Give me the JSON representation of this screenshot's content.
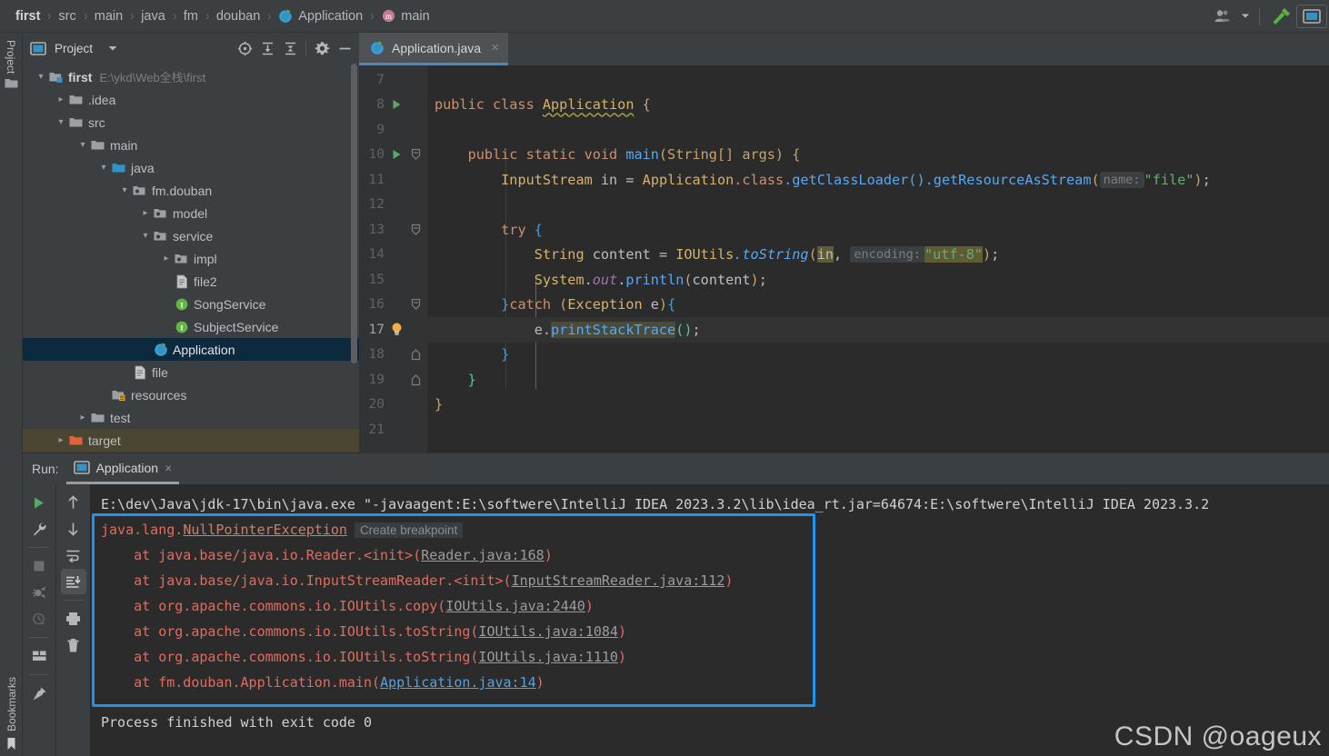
{
  "breadcrumb": {
    "items": [
      {
        "label": "first",
        "icon": null
      },
      {
        "label": "src",
        "icon": null
      },
      {
        "label": "main",
        "icon": null
      },
      {
        "label": "java",
        "icon": null
      },
      {
        "label": "fm",
        "icon": null
      },
      {
        "label": "douban",
        "icon": null
      },
      {
        "label": "Application",
        "icon": "java-class-run-icon"
      },
      {
        "label": "main",
        "icon": "method-icon"
      }
    ],
    "separator": "›"
  },
  "topbar_right": {
    "account_icon": "user-account-icon",
    "account_chevron": "chevron-down-icon",
    "build_icon": "hammer-icon",
    "layout_icon": "window-layout-icon"
  },
  "left_strip": {
    "project_label": "Project",
    "project_icon": "folder-icon",
    "bookmarks_label": "Bookmarks",
    "bookmarks_icon": "bookmark-icon"
  },
  "project_panel": {
    "title": "Project",
    "title_icon": "project-window-icon",
    "title_chevron": "chevron-down-icon",
    "toolbar": [
      {
        "name": "select-opened-file-icon",
        "label": "Select Opened File"
      },
      {
        "name": "expand-all-icon",
        "label": "Expand All"
      },
      {
        "name": "collapse-all-icon",
        "label": "Collapse All"
      },
      {
        "name": "settings-gear-icon",
        "label": "Settings"
      },
      {
        "name": "hide-icon",
        "label": "Hide"
      }
    ],
    "tree": [
      {
        "label": "first",
        "path": "E:\\ykd\\Web全栈\\first",
        "indent": 0,
        "arrow": "down",
        "icon": "module-icon",
        "bold": true,
        "state": "normal"
      },
      {
        "label": ".idea",
        "path": "",
        "indent": 1,
        "arrow": "right",
        "icon": "folder-icon",
        "bold": false,
        "state": "normal"
      },
      {
        "label": "src",
        "path": "",
        "indent": 1,
        "arrow": "down",
        "icon": "folder-icon",
        "bold": false,
        "state": "normal"
      },
      {
        "label": "main",
        "path": "",
        "indent": 2,
        "arrow": "down",
        "icon": "folder-icon",
        "bold": false,
        "state": "normal"
      },
      {
        "label": "java",
        "path": "",
        "indent": 3,
        "arrow": "down",
        "icon": "source-folder-icon",
        "bold": false,
        "state": "normal"
      },
      {
        "label": "fm.douban",
        "path": "",
        "indent": 4,
        "arrow": "down",
        "icon": "package-icon",
        "bold": false,
        "state": "normal"
      },
      {
        "label": "model",
        "path": "",
        "indent": 5,
        "arrow": "right",
        "icon": "package-icon",
        "bold": false,
        "state": "normal"
      },
      {
        "label": "service",
        "path": "",
        "indent": 5,
        "arrow": "down",
        "icon": "package-icon",
        "bold": false,
        "state": "normal"
      },
      {
        "label": "impl",
        "path": "",
        "indent": 6,
        "arrow": "right",
        "icon": "package-icon",
        "bold": false,
        "state": "normal"
      },
      {
        "label": "file2",
        "path": "",
        "indent": 6,
        "arrow": "none",
        "icon": "file-text-icon",
        "bold": false,
        "state": "normal"
      },
      {
        "label": "SongService",
        "path": "",
        "indent": 6,
        "arrow": "none",
        "icon": "interface-icon",
        "bold": false,
        "state": "normal"
      },
      {
        "label": "SubjectService",
        "path": "",
        "indent": 6,
        "arrow": "none",
        "icon": "interface-icon",
        "bold": false,
        "state": "normal"
      },
      {
        "label": "Application",
        "path": "",
        "indent": 5,
        "arrow": "none",
        "icon": "java-class-run-icon",
        "bold": false,
        "state": "selected"
      },
      {
        "label": "file",
        "path": "",
        "indent": 4,
        "arrow": "none",
        "icon": "file-text-icon",
        "bold": false,
        "state": "normal"
      },
      {
        "label": "resources",
        "path": "",
        "indent": 3,
        "arrow": "none",
        "icon": "resources-folder-icon",
        "bold": false,
        "state": "normal"
      },
      {
        "label": "test",
        "path": "",
        "indent": 2,
        "arrow": "right",
        "icon": "folder-icon",
        "bold": false,
        "state": "normal"
      },
      {
        "label": "target",
        "path": "",
        "indent": 1,
        "arrow": "right",
        "icon": "excluded-folder-icon",
        "bold": false,
        "state": "highlight"
      }
    ]
  },
  "editor": {
    "tab": {
      "label": "Application.java",
      "icon": "java-class-run-icon",
      "close": "×"
    },
    "lines": [
      {
        "num": "7",
        "marker": "",
        "fold": "",
        "current": false
      },
      {
        "num": "8",
        "marker": "run-gutter-icon",
        "fold": "",
        "current": false
      },
      {
        "num": "9",
        "marker": "",
        "fold": "",
        "current": false
      },
      {
        "num": "10",
        "marker": "run-gutter-icon",
        "fold": "fold-start",
        "current": false
      },
      {
        "num": "11",
        "marker": "",
        "fold": "",
        "current": false
      },
      {
        "num": "12",
        "marker": "",
        "fold": "",
        "current": false
      },
      {
        "num": "13",
        "marker": "",
        "fold": "fold-start",
        "current": false
      },
      {
        "num": "14",
        "marker": "",
        "fold": "",
        "current": false
      },
      {
        "num": "15",
        "marker": "",
        "fold": "",
        "current": false
      },
      {
        "num": "16",
        "marker": "",
        "fold": "fold-start",
        "current": false
      },
      {
        "num": "17",
        "marker": "lightbulb-icon",
        "fold": "",
        "current": true
      },
      {
        "num": "18",
        "marker": "",
        "fold": "fold-end",
        "current": false
      },
      {
        "num": "19",
        "marker": "",
        "fold": "fold-end",
        "current": false
      },
      {
        "num": "20",
        "marker": "",
        "fold": "",
        "current": false
      },
      {
        "num": "21",
        "marker": "",
        "fold": "",
        "current": false
      }
    ],
    "code": {
      "l7": "",
      "l8_kw": "public class",
      "l8_cls": "Application",
      "l8_brace": "{",
      "l9": "",
      "l10_kw": "public static void",
      "l10_meth": "main",
      "l10_args": "(String[] args) {",
      "l11_type": "InputStream",
      "l11_var": "in",
      "l11_eq": "=",
      "l11_cls": "Application",
      "l11_class_kw": ".class",
      "l11_m1": ".getClassLoader()",
      "l11_m2": ".getResourceAsStream",
      "l11_hint": "name:",
      "l11_str": "\"file\"",
      "l12": "",
      "l13_kw": "try",
      "l13_brace": "{",
      "l14_type": "String",
      "l14_var": "content",
      "l14_eq": "=",
      "l14_cls": "IOUtils",
      "l14_meth": ".toString",
      "l14_arg": "in",
      "l14_hint": "encoding:",
      "l14_str": "\"utf-8\"",
      "l15_cls": "System",
      "l15_fld": "out",
      "l15_meth": "println",
      "l15_arg": "content",
      "l16_catch": "}catch (Exception e){",
      "l17_var": "e.",
      "l17_meth": "printStackTrace",
      "l17_tail": "();",
      "l18": "}",
      "l19": "}",
      "l20": "}",
      "l21": ""
    }
  },
  "run_panel": {
    "label": "Run:",
    "tab": {
      "label": "Application",
      "icon": "run-config-icon",
      "close": "×"
    },
    "toolbar_left": [
      {
        "name": "rerun-play-icon",
        "active": false
      },
      {
        "name": "wrench-settings-icon",
        "active": false
      },
      {
        "name": "stop-square-icon",
        "active": false
      },
      {
        "name": "restart-debug-icon",
        "active": false
      },
      {
        "name": "history-clock-icon",
        "active": false
      },
      {
        "name": "layout-grid-icon",
        "active": false
      },
      {
        "name": "pin-icon",
        "active": false
      }
    ],
    "toolbar_right": [
      {
        "name": "up-arrow-icon",
        "active": false
      },
      {
        "name": "down-arrow-icon",
        "active": false
      },
      {
        "name": "soft-wrap-icon",
        "active": false
      },
      {
        "name": "scroll-to-end-icon",
        "active": true
      },
      {
        "name": "print-icon",
        "active": false
      },
      {
        "name": "trash-delete-icon",
        "active": false
      }
    ],
    "console": {
      "command_line": "E:\\dev\\Java\\jdk-17\\bin\\java.exe \"-javaagent:E:\\softwere\\IntelliJ IDEA 2023.3.2\\lib\\idea_rt.jar=64674:E:\\softwere\\IntelliJ IDEA 2023.3.2",
      "exception_prefix": "java.lang.",
      "exception_name": "NullPointerException",
      "create_breakpoint": "Create breakpoint",
      "stack": [
        {
          "at": "    at ",
          "text": "java.base/java.io.Reader.<init>",
          "open": "(",
          "link": "Reader.java:168",
          "close": ")",
          "link_style": "grey"
        },
        {
          "at": "    at ",
          "text": "java.base/java.io.InputStreamReader.<init>",
          "open": "(",
          "link": "InputStreamReader.java:112",
          "close": ")",
          "link_style": "grey"
        },
        {
          "at": "    at ",
          "text": "org.apache.commons.io.IOUtils.copy",
          "open": "(",
          "link": "IOUtils.java:2440",
          "close": ")",
          "link_style": "grey"
        },
        {
          "at": "    at ",
          "text": "org.apache.commons.io.IOUtils.toString",
          "open": "(",
          "link": "IOUtils.java:1084",
          "close": ")",
          "link_style": "grey"
        },
        {
          "at": "    at ",
          "text": "org.apache.commons.io.IOUtils.toString",
          "open": "(",
          "link": "IOUtils.java:1110",
          "close": ")",
          "link_style": "grey"
        },
        {
          "at": "    at ",
          "text": "fm.douban.Application.main",
          "open": "(",
          "link": "Application.java:14",
          "close": ")",
          "link_style": "blue"
        }
      ],
      "process_finished": "Process finished with exit code 0"
    }
  },
  "watermark": "CSDN @oageux",
  "colors": {
    "accent_blue": "#1e93f0",
    "tab_underline": "#4a88c7",
    "selection_bg": "#0d293e",
    "error_red": "#e06c5f",
    "keyword_orange": "#cc7832",
    "string_green": "#6aab73",
    "editor_bg": "#2b2b2b",
    "panel_bg": "#3c3f41"
  }
}
